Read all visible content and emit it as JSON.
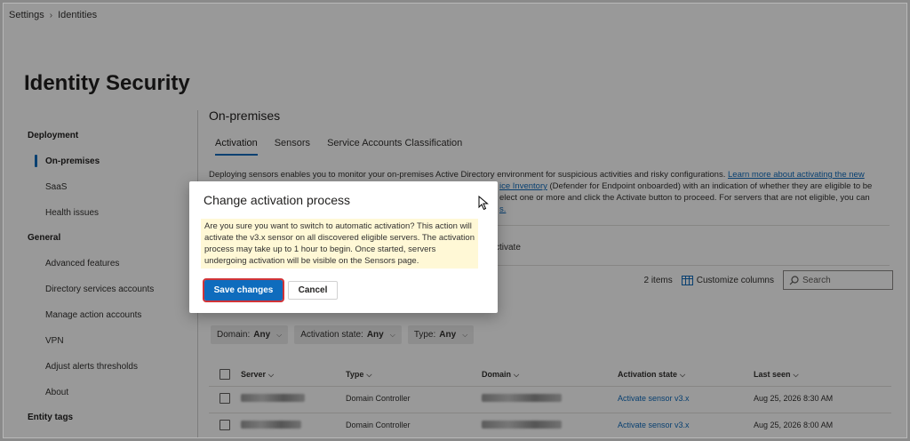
{
  "breadcrumb": [
    "Settings",
    "Identities"
  ],
  "page_title": "Identity Security",
  "nav": {
    "groups": [
      {
        "label": "Deployment",
        "items": [
          "On-premises",
          "SaaS",
          "Health issues"
        ]
      },
      {
        "label": "General",
        "items": [
          "Advanced features",
          "Directory services accounts",
          "Manage action accounts",
          "VPN",
          "Adjust alerts thresholds",
          "About"
        ]
      },
      {
        "label": "Entity tags",
        "items": []
      }
    ],
    "active_item": "On-premises"
  },
  "main": {
    "section_title": "On-premises",
    "tabs": [
      "Activation",
      "Sensors",
      "Service Accounts Classification"
    ],
    "active_tab": "Activation",
    "description": {
      "line1_start": "Deploying sensors enables you to monitor your on-premises Active Directory environment for suspicious activities and risky configurations.",
      "line1_link": "Learn more about activating the new",
      "line2_link": "ice Inventory",
      "line2_rest": " (Defender for Endpoint onboarded) with an indication of whether they are eligible to be",
      "line3": "elect one or more and click the Activate button to proceed. For servers that are not eligible, you can",
      "line4_link": "s."
    },
    "activate_label": "ctivate",
    "items_count": "2 items",
    "customize_columns": "Customize columns",
    "search_placeholder": "Search",
    "filters": [
      {
        "label": "Domain:",
        "value": "Any"
      },
      {
        "label": "Activation state:",
        "value": "Any"
      },
      {
        "label": "Type:",
        "value": "Any"
      }
    ],
    "table": {
      "headers": [
        "Server",
        "Type",
        "Domain",
        "Activation state",
        "Last seen"
      ],
      "rows": [
        {
          "type": "Domain Controller",
          "activation": "Activate sensor v3.x",
          "last_seen": "Aug 25, 2026 8:30 AM"
        },
        {
          "type": "Domain Controller",
          "activation": "Activate sensor v3.x",
          "last_seen": "Aug 25, 2026 8:00 AM"
        }
      ]
    }
  },
  "dialog": {
    "title": "Change activation process",
    "message": "Are you sure you want to switch to automatic activation? This action will activate the v3.x sensor on all discovered eligible servers. The activation process may take up to 1 hour to begin. Once started, servers undergoing activation will be visible on the Sensors page.",
    "primary": "Save changes",
    "secondary": "Cancel"
  },
  "colors": {
    "accent": "#0f6cbd",
    "highlight": "#fff8d6",
    "focus_outline": "#d13438"
  }
}
